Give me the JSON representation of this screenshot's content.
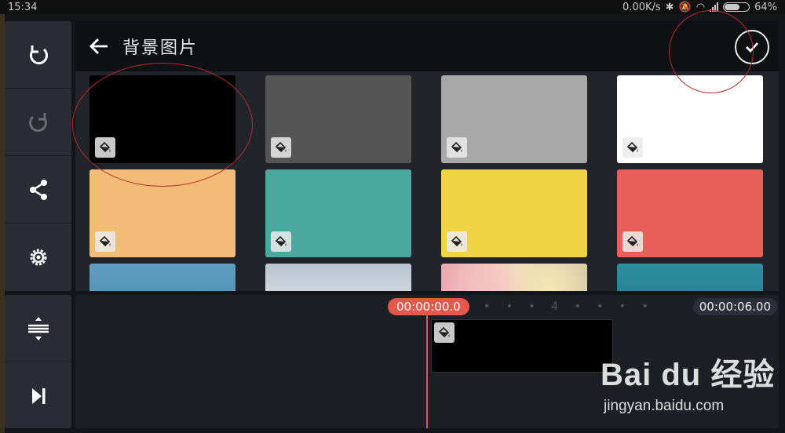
{
  "status_bar": {
    "time": "15:34",
    "speed": "0.00K/s",
    "battery": "64%",
    "battery_level": 0.64
  },
  "header": {
    "title": "背景图片"
  },
  "left_tools": [
    "undo-icon",
    "redo-icon",
    "share-icon",
    "settings-icon"
  ],
  "bottom_tools": [
    "split-icon",
    "skip-to-end-icon"
  ],
  "swatches": [
    {
      "color": "#000000",
      "selected": true
    },
    {
      "color": "#555555"
    },
    {
      "color": "#a8a8a8"
    },
    {
      "color": "#ffffff"
    },
    {
      "color": "#f3bb78"
    },
    {
      "color": "#4aa89f"
    },
    {
      "color": "#f1d446"
    },
    {
      "color": "#e85f57"
    },
    {
      "color": "#4a8db0",
      "image": "sky"
    },
    {
      "color": "#c4ccd6",
      "image": "clouds"
    },
    {
      "color": "#f0d5c9",
      "image": "bokeh"
    },
    {
      "color": "#2f8ea0",
      "image": "ocean"
    }
  ],
  "timeline": {
    "current_time": "00:00:00.0",
    "total_time": "00:00:06.00",
    "marker": "4"
  },
  "watermark": {
    "logo": "Bai du 经验",
    "url": "jingyan.baidu.com"
  }
}
